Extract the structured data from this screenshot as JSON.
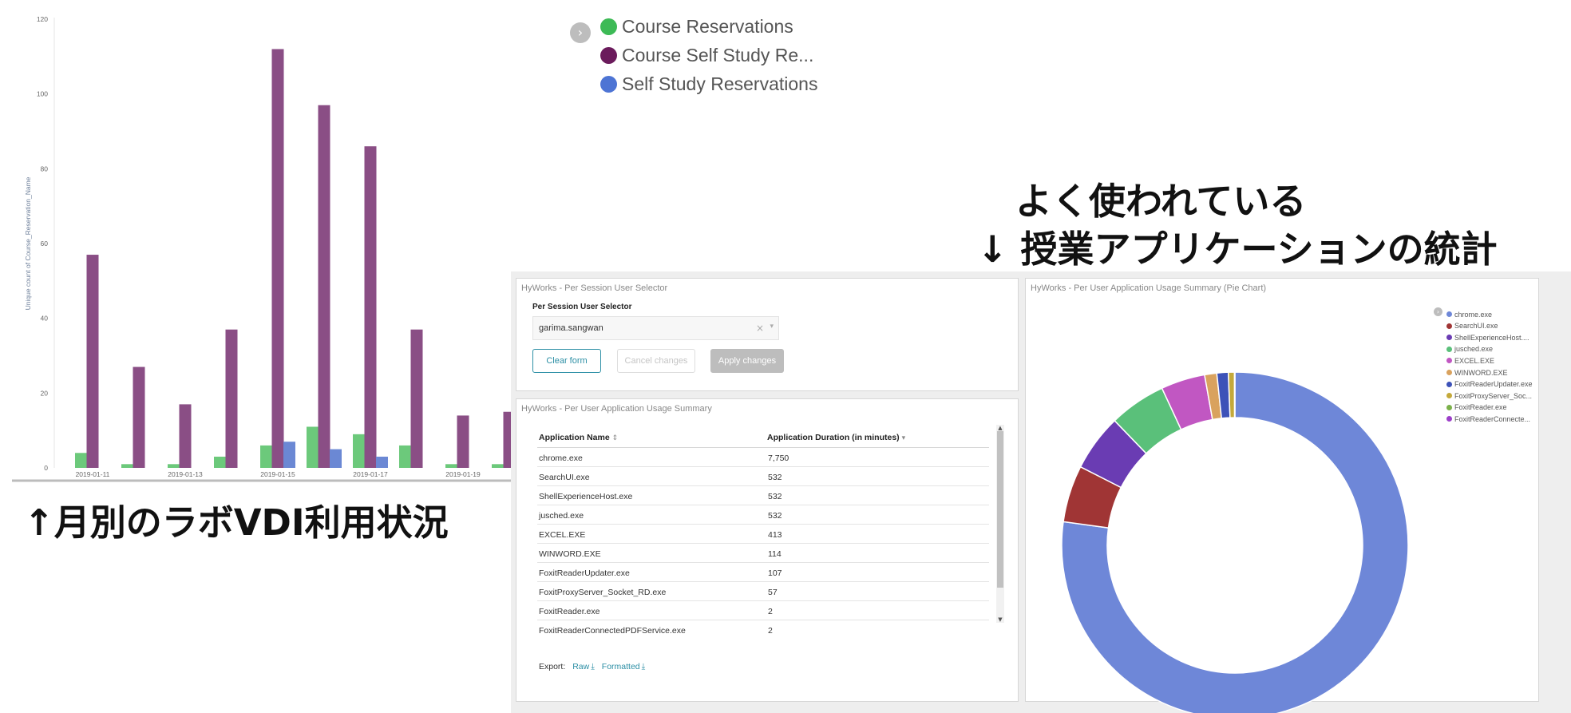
{
  "chart_data": {
    "type": "bar",
    "ylabel": "Unique count of Course_Reservation_Name",
    "xlabel": "",
    "ylim": [
      0,
      120
    ],
    "yticks": [
      0,
      20,
      40,
      60,
      80,
      100,
      120
    ],
    "categories": [
      "2019-01-11",
      "2019-01-12",
      "2019-01-13",
      "2019-01-14",
      "2019-01-15",
      "2019-01-16",
      "2019-01-17",
      "2019-01-18",
      "2019-01-19",
      "2019-01-20"
    ],
    "x_tick_labels": [
      "2019-01-11",
      "",
      "2019-01-13",
      "",
      "2019-01-15",
      "",
      "2019-01-17",
      "",
      "2019-01-19",
      ""
    ],
    "series": [
      {
        "name": "Course Reservations",
        "color": "#6cc97b",
        "values": [
          4,
          1,
          1,
          3,
          6,
          11,
          9,
          6,
          1,
          1
        ]
      },
      {
        "name": "Course Self Study Re...",
        "color": "#8a4e85",
        "values": [
          57,
          27,
          17,
          37,
          112,
          97,
          86,
          37,
          14,
          15
        ]
      },
      {
        "name": "Self Study Reservations",
        "color": "#6b88d4",
        "values": [
          0,
          0,
          0,
          0,
          7,
          5,
          3,
          0,
          0,
          0
        ]
      }
    ],
    "legend_position": "top-right"
  },
  "legend": {
    "toggle_icon": "›",
    "items": [
      {
        "label": "Course Reservations",
        "color": "#3dba56"
      },
      {
        "label": "Course Self Study Re...",
        "color": "#6b1b5c"
      },
      {
        "label": "Self Study Reservations",
        "color": "#4d74d4"
      }
    ]
  },
  "annotations": {
    "left_caption": "↑月別のラボVDI利用状況",
    "right_line1": "よく使われている",
    "right_line2": "↓ 授業アプリケーションの統計"
  },
  "selector_panel": {
    "title": "HyWorks - Per Session User Selector",
    "field_label": "Per Session User Selector",
    "field_value": "garima.sangwan",
    "clear_icon": "×",
    "caret_icon": "▾",
    "buttons": {
      "clear": "Clear form",
      "cancel": "Cancel changes",
      "apply": "Apply changes"
    }
  },
  "usage_table": {
    "title": "HyWorks - Per User Application Usage Summary",
    "columns": [
      "Application Name",
      "Application Duration (in minutes)"
    ],
    "sort_icons": [
      "⇕",
      "▾"
    ],
    "rows": [
      [
        "chrome.exe",
        "7,750"
      ],
      [
        "SearchUI.exe",
        "532"
      ],
      [
        "ShellExperienceHost.exe",
        "532"
      ],
      [
        "jusched.exe",
        "532"
      ],
      [
        "EXCEL.EXE",
        "413"
      ],
      [
        "WINWORD.EXE",
        "114"
      ],
      [
        "FoxitReaderUpdater.exe",
        "107"
      ],
      [
        "FoxitProxyServer_Socket_RD.exe",
        "57"
      ],
      [
        "FoxitReader.exe",
        "2"
      ],
      [
        "FoxitReaderConnectedPDFService.exe",
        "2"
      ]
    ],
    "export_label": "Export:",
    "export_raw": "Raw",
    "export_formatted": "Formatted",
    "download_icon": "⤓"
  },
  "pie_panel": {
    "title": "HyWorks - Per User Application Usage Summary (Pie Chart)",
    "slices": [
      {
        "label": "chrome.exe",
        "value": 7750,
        "color": "#6e87d8"
      },
      {
        "label": "SearchUI.exe",
        "value": 532,
        "color": "#a03535"
      },
      {
        "label": "ShellExperienceHost....",
        "value": 532,
        "color": "#6a3cb3"
      },
      {
        "label": "jusched.exe",
        "value": 532,
        "color": "#5ac07a"
      },
      {
        "label": "EXCEL.EXE",
        "value": 413,
        "color": "#c157c2"
      },
      {
        "label": "WINWORD.EXE",
        "value": 114,
        "color": "#d9a25e"
      },
      {
        "label": "FoxitReaderUpdater.exe",
        "value": 107,
        "color": "#3d52b8"
      },
      {
        "label": "FoxitProxyServer_Soc...",
        "value": 57,
        "color": "#c4a93a"
      },
      {
        "label": "FoxitReader.exe",
        "value": 2,
        "color": "#7bb14a"
      },
      {
        "label": "FoxitReaderConnecte...",
        "value": 2,
        "color": "#9c3fc9"
      }
    ]
  }
}
